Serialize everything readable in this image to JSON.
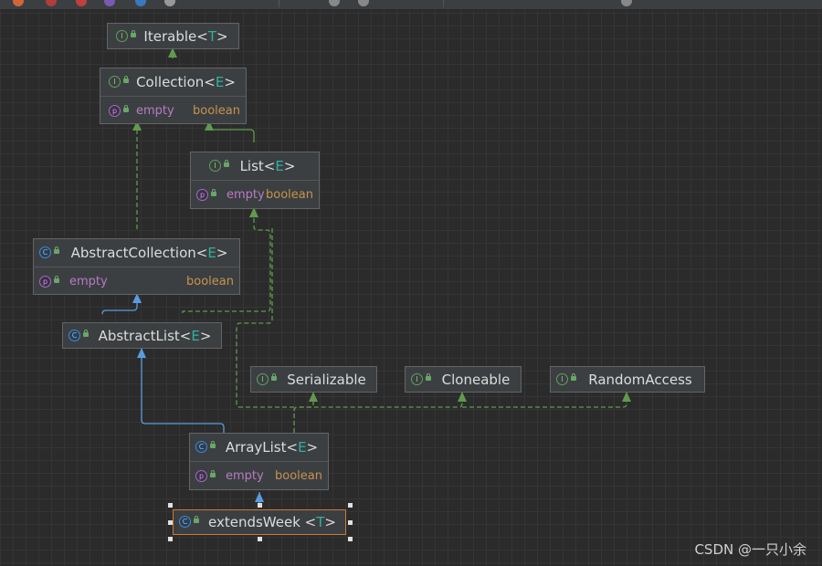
{
  "nodes": {
    "iterable": {
      "name": "Iterable",
      "tparam": "T"
    },
    "collection": {
      "name": "Collection",
      "tparam": "E",
      "prop": "empty",
      "ptype": "boolean"
    },
    "list": {
      "name": "List",
      "tparam": "E",
      "prop": "empty",
      "ptype": "boolean"
    },
    "abstract_collection": {
      "name": "AbstractCollection",
      "tparam": "E",
      "prop": "empty",
      "ptype": "boolean"
    },
    "abstract_list": {
      "name": "AbstractList",
      "tparam": "E"
    },
    "serializable": {
      "name": "Serializable"
    },
    "cloneable": {
      "name": "Cloneable"
    },
    "random_access": {
      "name": "RandomAccess"
    },
    "array_list": {
      "name": "ArrayList",
      "tparam": "E",
      "prop": "empty",
      "ptype": "boolean"
    },
    "extends_week": {
      "name": "extendsWeek",
      "tparam": "T"
    }
  },
  "icons": {
    "interface": "I",
    "class": "C",
    "property": "p"
  },
  "colors": {
    "implements_edge": "#5f9a4e",
    "extends_edge": "#5a9be0",
    "selection": "#c77b32"
  },
  "watermark": "CSDN @一只小余"
}
